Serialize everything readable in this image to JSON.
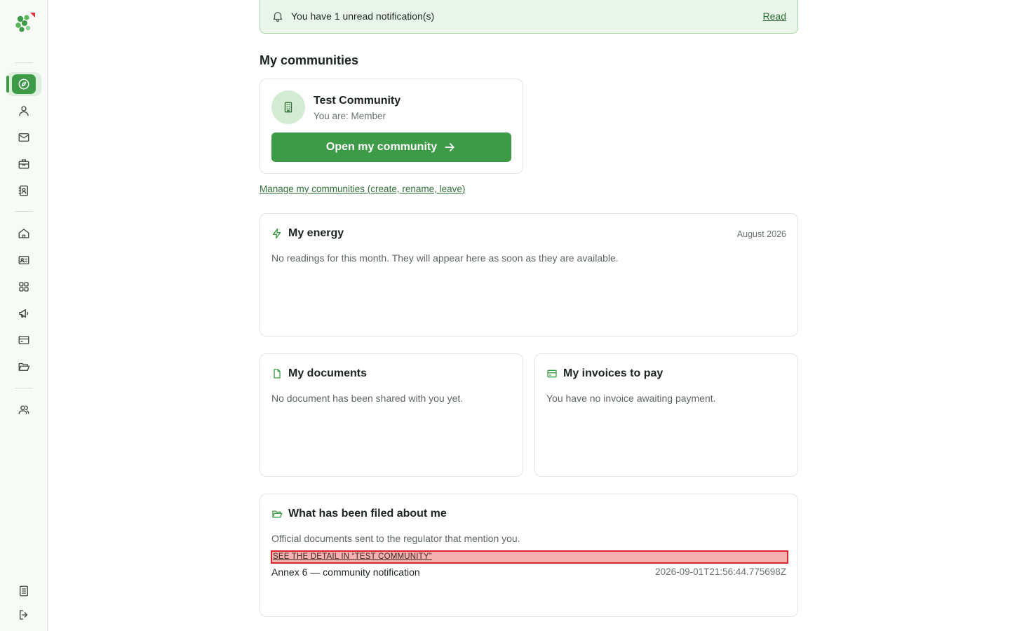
{
  "notification": {
    "text": "You have 1 unread notification(s)",
    "link": "Read"
  },
  "section_title": "My communities",
  "community": {
    "name": "Test Community",
    "role": "You are: Member",
    "open_button": "Open my community"
  },
  "manage_link": "Manage my communities (create, rename, leave)",
  "energy": {
    "title": "My energy",
    "date": "August 2026",
    "empty": "No readings for this month. They will appear here as soon as they are available."
  },
  "documents": {
    "title": "My documents",
    "empty": "No document has been shared with you yet."
  },
  "invoices": {
    "title": "My invoices to pay",
    "empty": "You have no invoice awaiting payment."
  },
  "filed": {
    "title": "What has been filed about me",
    "subtitle": "Official documents sent to the regulator that mention you.",
    "detail_link": "SEE THE DETAIL IN “TEST COMMUNITY”",
    "items": [
      {
        "name": "Annex 6 — community notification",
        "timestamp": "2026-09-01T21:56:44.775698Z"
      }
    ]
  },
  "sidebar": {
    "icons": [
      "compass-icon",
      "user-icon",
      "mail-icon",
      "briefcase-icon",
      "contact-book-icon",
      "home-icon",
      "id-card-icon",
      "grid-icon",
      "megaphone-icon",
      "credit-card-icon",
      "folder-open-icon",
      "users-icon",
      "document-list-icon",
      "logout-icon"
    ],
    "active": "compass-icon"
  },
  "colors": {
    "brand_green": "#3d9a47",
    "notif_bg": "#e9f5e8",
    "highlight_red": "#d9262b"
  }
}
